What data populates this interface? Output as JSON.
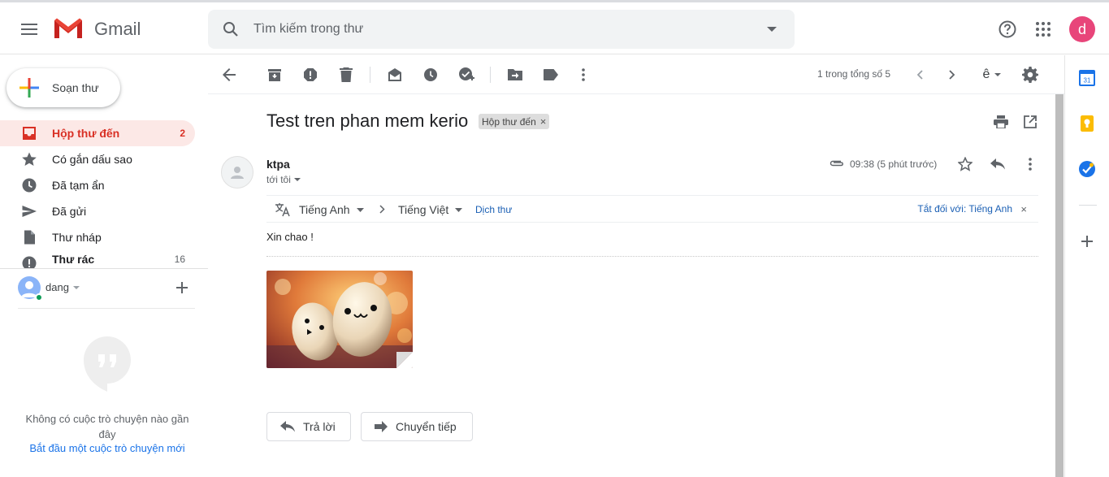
{
  "app": {
    "brand": "Gmail",
    "avatar_letter": "d"
  },
  "search": {
    "placeholder": "Tìm kiếm trong thư"
  },
  "sidebar": {
    "compose_label": "Soạn thư",
    "items": [
      {
        "label": "Hộp thư đến",
        "count": "2",
        "icon": "inbox-icon"
      },
      {
        "label": "Có gắn dấu sao",
        "count": "",
        "icon": "star-icon"
      },
      {
        "label": "Đã tạm ẩn",
        "count": "",
        "icon": "clock-icon"
      },
      {
        "label": "Đã gửi",
        "count": "",
        "icon": "send-icon"
      },
      {
        "label": "Thư nháp",
        "count": "",
        "icon": "draft-icon"
      },
      {
        "label": "Thư rác",
        "count": "16",
        "icon": "spam-icon"
      }
    ],
    "hangouts_user": "dang",
    "no_chats": "Không có cuộc trò chuyện nào gần đây",
    "start_chat": "Bắt đầu một cuộc trò chuyện mới"
  },
  "toolbar": {
    "pager": "1 trong tổng số 5",
    "input_tool": "ê"
  },
  "message": {
    "subject": "Test tren phan mem kerio",
    "label": "Hộp thư đến",
    "label_remove": "×",
    "sender": "ktpa",
    "recipient": "tới tôi",
    "time": "09:38 (5 phút trước)",
    "body": "Xin chao !",
    "translate": {
      "from": "Tiếng Anh",
      "to": "Tiếng Việt",
      "action": "Dịch thư",
      "turn_off": "Tắt đối với: Tiếng Anh",
      "close": "×"
    },
    "reply_label": "Trả lời",
    "forward_label": "Chuyển tiếp"
  },
  "right_panel": {
    "calendar_day": "31"
  },
  "colors": {
    "accent_red": "#d93025",
    "link_blue": "#1a5fb4",
    "avatar_pink": "#e8457a",
    "active_bg": "#fce8e6"
  }
}
